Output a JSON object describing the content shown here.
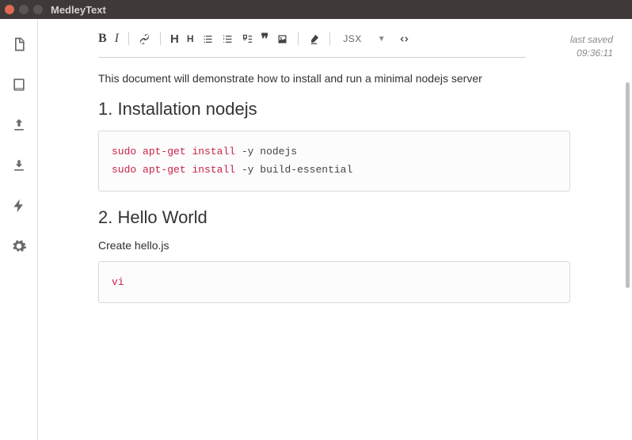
{
  "window": {
    "title": "MedleyText"
  },
  "toolbar": {
    "code_lang": "JSX"
  },
  "saved": {
    "label": "last saved",
    "time": "09:36:11"
  },
  "doc": {
    "intro": "This document will demonstrate how to install and run a minimal nodejs server",
    "h1": "1. Installation nodejs",
    "code1_lines": [
      [
        {
          "t": "sudo",
          "kw": true
        },
        {
          "t": " "
        },
        {
          "t": "apt-get",
          "kw": true
        },
        {
          "t": " "
        },
        {
          "t": "install",
          "kw": true
        },
        {
          "t": " -y nodejs"
        }
      ],
      [
        {
          "t": "sudo",
          "kw": true
        },
        {
          "t": " "
        },
        {
          "t": "apt-get",
          "kw": true
        },
        {
          "t": " "
        },
        {
          "t": "install",
          "kw": true
        },
        {
          "t": " -y build-essential"
        }
      ]
    ],
    "h2": "2. Hello World",
    "p2": "Create hello.js",
    "code2_lines": [
      [
        {
          "t": "vi",
          "kw": true
        }
      ]
    ]
  }
}
